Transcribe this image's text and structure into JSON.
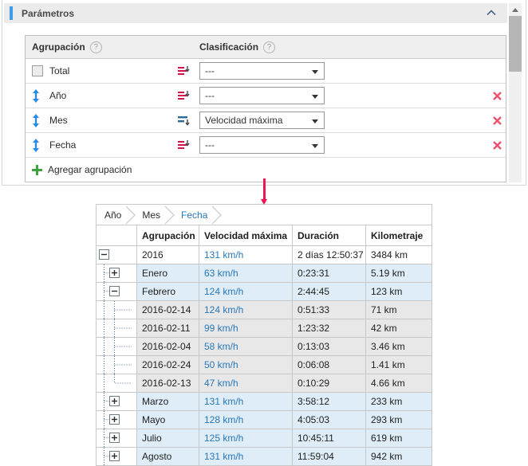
{
  "panel": {
    "title": "Parámetros",
    "column_agrupacion": "Agrupación",
    "column_clasificacion": "Clasificación",
    "help_glyph": "?",
    "rows": [
      {
        "label": "Total",
        "selected": "---"
      },
      {
        "label": "Año",
        "selected": "---"
      },
      {
        "label": "Mes",
        "selected": "Velocidad máxima"
      },
      {
        "label": "Fecha",
        "selected": "---"
      }
    ],
    "add_label": "Agregar agrupación"
  },
  "colors": {
    "accent_blue": "#3d9be9",
    "link_blue": "#2878b8",
    "sort_red": "#d4124a",
    "sort_blue": "#2d6a94",
    "flow_arrow": "#ed1651",
    "month_row_bg": "#deedf7",
    "date_row_bg": "#e8e8e8"
  },
  "table": {
    "breadcrumbs": {
      "0": "Año",
      "1": "Mes",
      "2": "Fecha"
    },
    "active_breadcrumb": "Fecha",
    "headers": {
      "group": "Agrupación",
      "speed": "Velocidad máxima",
      "duration": "Duración",
      "distance": "Kilometraje"
    },
    "rows": [
      {
        "name": "2016",
        "speed": "131 km/h",
        "duration": "2 días 12:50:37",
        "distance": "3484 km"
      },
      {
        "name": "Enero",
        "speed": "63 km/h",
        "duration": "0:23:31",
        "distance": "5.19 km"
      },
      {
        "name": "Febrero",
        "speed": "124 km/h",
        "duration": "2:44:45",
        "distance": "123 km"
      },
      {
        "name": "2016-02-14",
        "speed": "124 km/h",
        "duration": "0:51:33",
        "distance": "71 km"
      },
      {
        "name": "2016-02-11",
        "speed": "99 km/h",
        "duration": "1:23:32",
        "distance": "42 km"
      },
      {
        "name": "2016-02-04",
        "speed": "58 km/h",
        "duration": "0:13:03",
        "distance": "3.46 km"
      },
      {
        "name": "2016-02-24",
        "speed": "50 km/h",
        "duration": "0:06:08",
        "distance": "1.41 km"
      },
      {
        "name": "2016-02-13",
        "speed": "47 km/h",
        "duration": "0:10:29",
        "distance": "4.66 km"
      },
      {
        "name": "Marzo",
        "speed": "131 km/h",
        "duration": "3:58:12",
        "distance": "233 km"
      },
      {
        "name": "Mayo",
        "speed": "128 km/h",
        "duration": "4:05:03",
        "distance": "293 km"
      },
      {
        "name": "Julio",
        "speed": "125 km/h",
        "duration": "10:45:11",
        "distance": "619 km"
      },
      {
        "name": "Agosto",
        "speed": "131 km/h",
        "duration": "11:59:04",
        "distance": "942 km"
      }
    ]
  }
}
